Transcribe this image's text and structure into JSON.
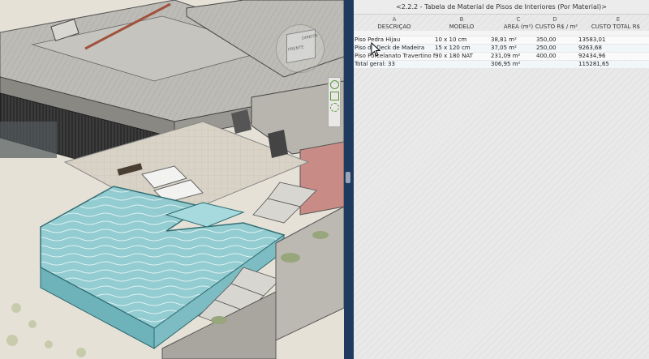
{
  "schedule": {
    "title": "<2.2.2 - Tabela de Material de Pisos de Interiores (Por Material)>",
    "column_letters": [
      "A",
      "B",
      "C",
      "D",
      "E"
    ],
    "headers": [
      "DESCRIÇÃO",
      "MODELO",
      "ÁREA (m²)",
      "CUSTO R$ / m²",
      "CUSTO TOTAL R$"
    ],
    "rows": [
      [
        "Piso Pedra Hijau",
        "10 x 10  cm",
        "38,81 m²",
        "350,00",
        "13583,01"
      ],
      [
        "Piso de Deck de Madeira",
        "15 x 120 cm",
        "37,05 m²",
        "250,00",
        "9263,68"
      ],
      [
        "Piso Porcelanato Travertino Navona",
        "90 x 180 NAT",
        "231,09 m²",
        "400,00",
        "92434,96"
      ]
    ],
    "total": [
      "Total geral: 33",
      "",
      "306,95 m²",
      "",
      "115281,65"
    ]
  },
  "viewcube": {
    "front_label": "FRENTE",
    "side_label": "DIREITA"
  },
  "colors": {
    "accent": "#1f3a5f",
    "pool_water": "#8cc9cf",
    "wall_clay": "#c98b85",
    "roof": "#b9b7b2"
  }
}
